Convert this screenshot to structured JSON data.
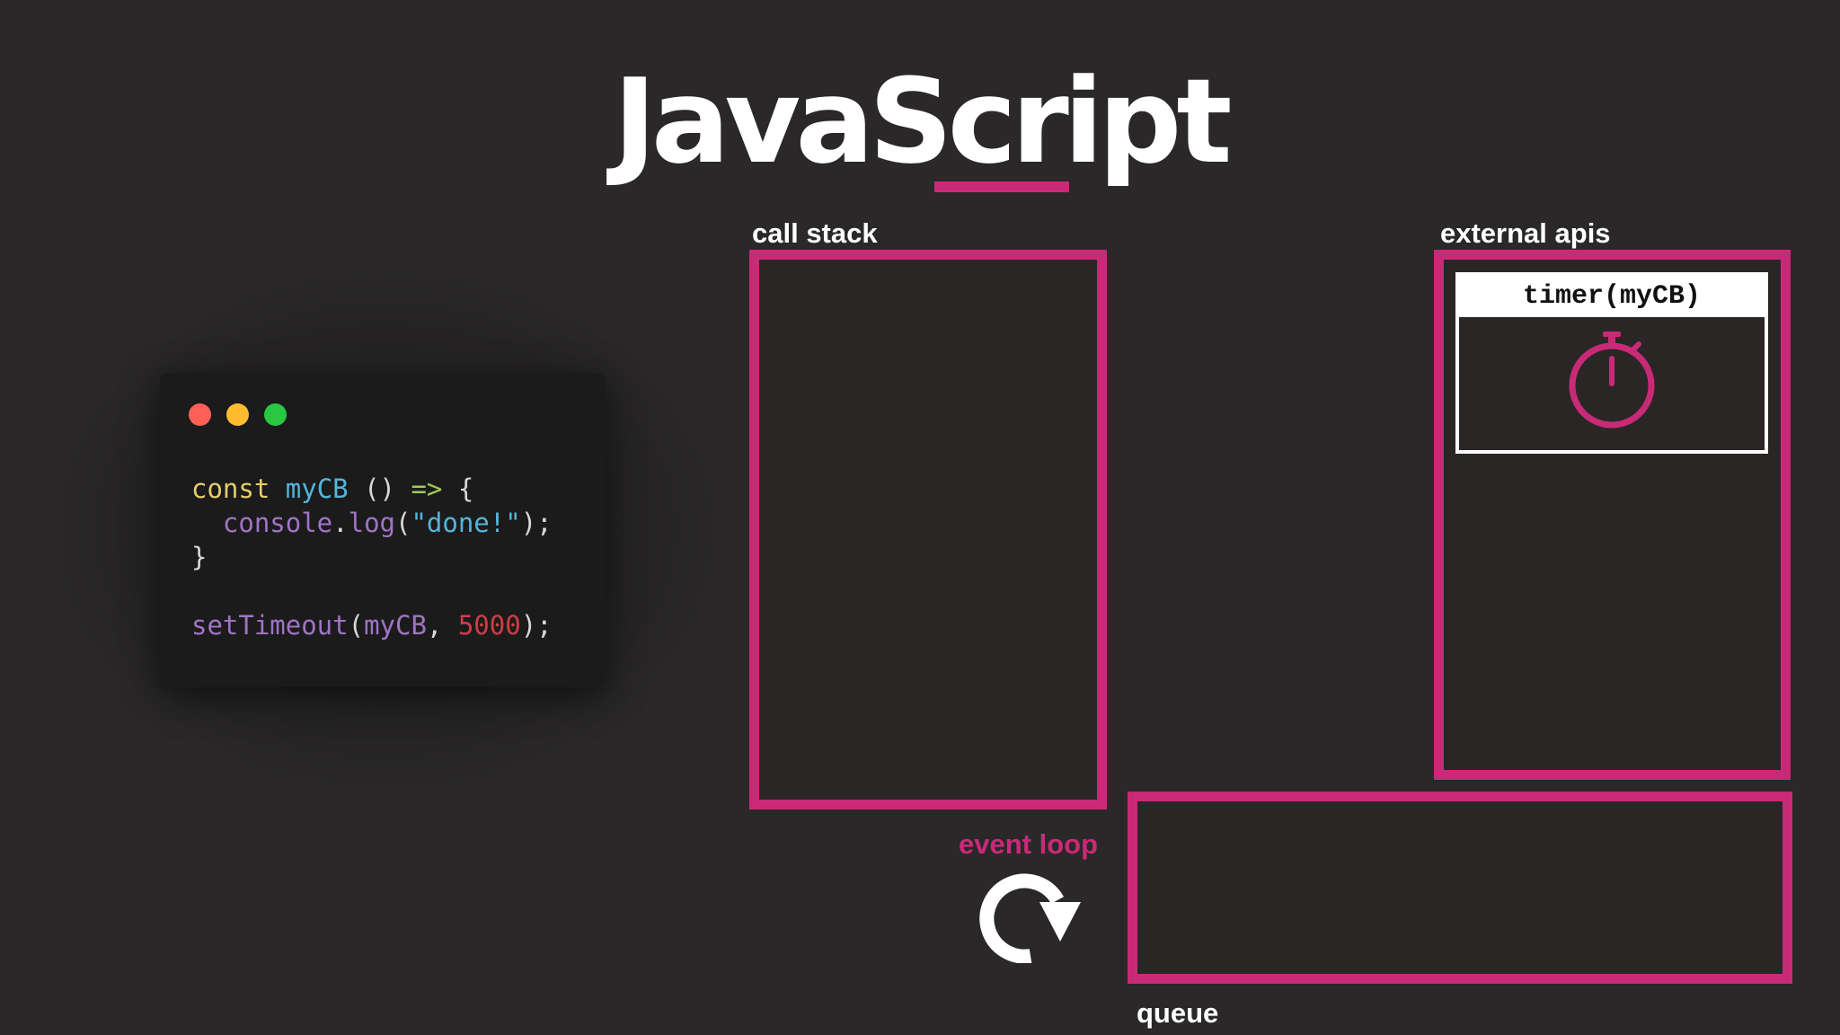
{
  "title": "JavaScript",
  "colors": {
    "accent": "#c92a78",
    "background": "#2a2828",
    "code_background": "#1b1b1c"
  },
  "code_window": {
    "traffic_lights": [
      "#fe5f57",
      "#febc2e",
      "#28c840"
    ],
    "lines": [
      [
        {
          "text": "const",
          "color": "#e6cd69"
        },
        {
          "text": " ",
          "color": "#d8d8d8"
        },
        {
          "text": "myCB",
          "color": "#55b5db"
        },
        {
          "text": " () ",
          "color": "#d8d8d8"
        },
        {
          "text": "=>",
          "color": "#9fca56"
        },
        {
          "text": " {",
          "color": "#d8d8d8"
        }
      ],
      [
        {
          "text": "  console",
          "color": "#a074c4"
        },
        {
          "text": ".",
          "color": "#d8d8d8"
        },
        {
          "text": "log",
          "color": "#a074c4"
        },
        {
          "text": "(",
          "color": "#d8d8d8"
        },
        {
          "text": "\"done!\"",
          "color": "#55b5db"
        },
        {
          "text": ");",
          "color": "#d8d8d8"
        }
      ],
      [
        {
          "text": "}",
          "color": "#d8d8d8"
        }
      ],
      [],
      [
        {
          "text": "setTimeout",
          "color": "#a074c4"
        },
        {
          "text": "(",
          "color": "#d8d8d8"
        },
        {
          "text": "myCB",
          "color": "#a074c4"
        },
        {
          "text": ", ",
          "color": "#d8d8d8"
        },
        {
          "text": "5000",
          "color": "#cd3f45"
        },
        {
          "text": ");",
          "color": "#d8d8d8"
        }
      ]
    ]
  },
  "call_stack": {
    "label": "call stack"
  },
  "external_apis": {
    "label": "external apis",
    "timer": {
      "label": "timer(myCB)",
      "icon": "stopwatch-icon"
    }
  },
  "event_loop": {
    "label": "event loop",
    "icon": "refresh-arrow-icon"
  },
  "queue": {
    "label": "queue"
  }
}
